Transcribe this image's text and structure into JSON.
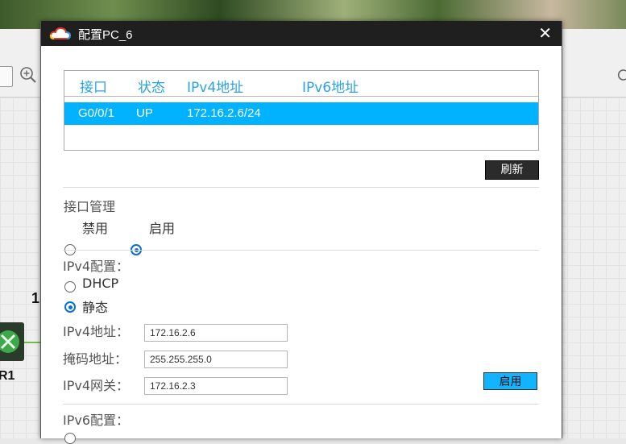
{
  "window": {
    "title": "配置PC_6"
  },
  "background": {
    "device_label_number": "1",
    "device_label_name": "R1"
  },
  "interface_table": {
    "headers": [
      "接口",
      "状态",
      "IPv4地址",
      "IPv6地址"
    ],
    "rows": [
      {
        "interface": "G0/0/1",
        "status": "UP",
        "ipv4": "172.16.2.6/24",
        "ipv6": ""
      }
    ]
  },
  "refresh_label": "刷新",
  "interface_mgmt": {
    "title": "接口管理",
    "options": [
      {
        "label": "禁用",
        "selected": false
      },
      {
        "label": "启用",
        "selected": true
      }
    ]
  },
  "ipv4_config": {
    "title": "IPv4配置：",
    "options": [
      {
        "label": "DHCP",
        "selected": false
      },
      {
        "label": "静态",
        "selected": true
      }
    ],
    "address_label": "IPv4地址：",
    "address_value": "172.16.2.6",
    "mask_label": "掩码地址：",
    "mask_value": "255.255.255.0",
    "gateway_label": "IPv4网关：",
    "gateway_value": "172.16.2.3",
    "apply_label": "启用"
  },
  "ipv6_config": {
    "title": "IPv6配置："
  },
  "colors": {
    "accent": "#00b2ff",
    "header_text": "#29a3e0",
    "titlebar": "#1f1f1f"
  }
}
